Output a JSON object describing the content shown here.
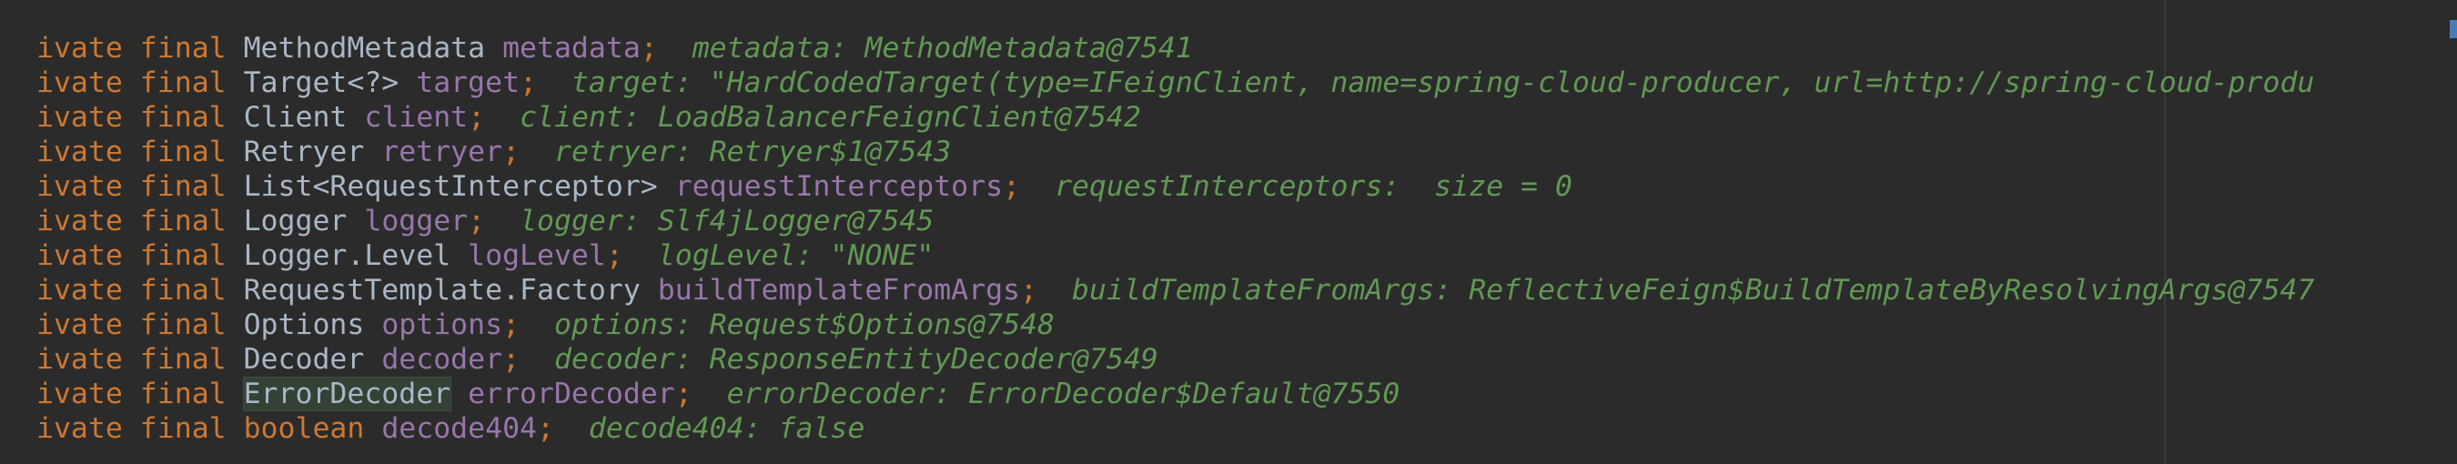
{
  "colors": {
    "background": "#2b2b2b",
    "keyword": "#cc7832",
    "type": "#a9b7c6",
    "field": "#9876aa",
    "inlay_hint": "#629755",
    "usage_highlight": "#344134"
  },
  "lines": [
    {
      "mod1": "ivate",
      "mod2": "final",
      "type": "MethodMetadata",
      "name": "metadata",
      "semi": ";",
      "hint": "metadata: MethodMetadata@7541"
    },
    {
      "mod1": "ivate",
      "mod2": "final",
      "type": "Target<?>",
      "name": "target",
      "semi": ";",
      "hint": "target: \"HardCodedTarget(type=IFeignClient, name=spring-cloud-producer, url=http://spring-cloud-produ"
    },
    {
      "mod1": "ivate",
      "mod2": "final",
      "type": "Client",
      "name": "client",
      "semi": ";",
      "hint": "client: LoadBalancerFeignClient@7542"
    },
    {
      "mod1": "ivate",
      "mod2": "final",
      "type": "Retryer",
      "name": "retryer",
      "semi": ";",
      "hint": "retryer: Retryer$1@7543"
    },
    {
      "mod1": "ivate",
      "mod2": "final",
      "type": "List<RequestInterceptor>",
      "name": "requestInterceptors",
      "semi": ";",
      "hint": "requestInterceptors:  size = 0"
    },
    {
      "mod1": "ivate",
      "mod2": "final",
      "type": "Logger",
      "name": "logger",
      "semi": ";",
      "hint": "logger: Slf4jLogger@7545"
    },
    {
      "mod1": "ivate",
      "mod2": "final",
      "type": "Logger.Level",
      "name": "logLevel",
      "semi": ";",
      "hint": "logLevel: \"NONE\""
    },
    {
      "mod1": "ivate",
      "mod2": "final",
      "type": "RequestTemplate.Factory",
      "name": "buildTemplateFromArgs",
      "semi": ";",
      "hint": "buildTemplateFromArgs: ReflectiveFeign$BuildTemplateByResolvingArgs@7547"
    },
    {
      "mod1": "ivate",
      "mod2": "final",
      "type": "Options",
      "name": "options",
      "semi": ";",
      "hint": "options: Request$Options@7548"
    },
    {
      "mod1": "ivate",
      "mod2": "final",
      "type": "Decoder",
      "name": "decoder",
      "semi": ";",
      "hint": "decoder: ResponseEntityDecoder@7549"
    },
    {
      "mod1": "ivate",
      "mod2": "final",
      "type": "ErrorDecoder",
      "name": "errorDecoder",
      "semi": ";",
      "hint": "errorDecoder: ErrorDecoder$Default@7550"
    },
    {
      "mod1": "ivate",
      "mod2": "final",
      "type": "boolean",
      "name": "decode404",
      "semi": ";",
      "hint": "decode404: false"
    }
  ]
}
